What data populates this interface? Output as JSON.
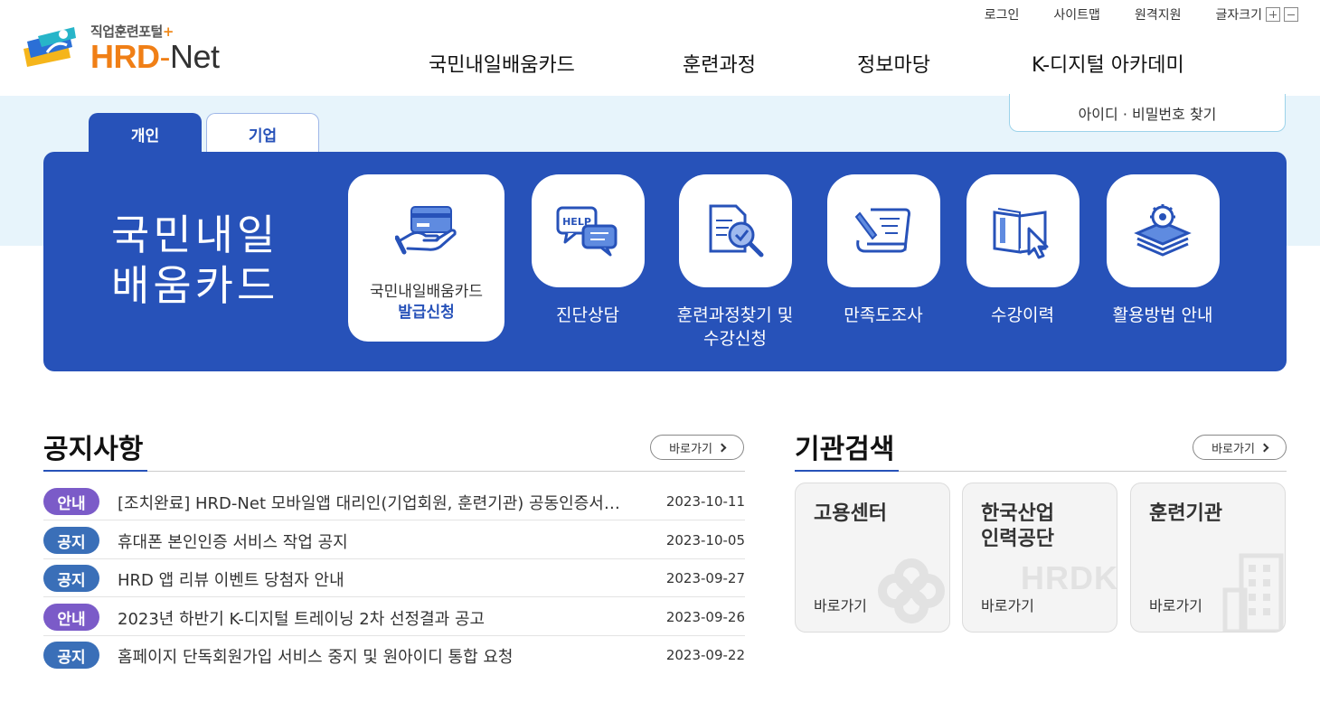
{
  "utility": {
    "login": "로그인",
    "sitemap": "사이트맵",
    "remote": "원격지원",
    "fontsize": "글자크기"
  },
  "logo": {
    "tagline": "직업훈련포털",
    "tagline_plus": "+",
    "brand_hrd": "HRD",
    "brand_dash": "-",
    "brand_net": "Net"
  },
  "gnb": [
    "국민내일배움카드",
    "훈련과정",
    "정보마당",
    "K-디지털 아카데미"
  ],
  "find_id": "아이디 · 비밀번호 찾기",
  "tabs": {
    "personal": "개인",
    "corporate": "기업"
  },
  "panel": {
    "title_line1": "국민내일",
    "title_line2": "배움카드",
    "card": {
      "line1": "국민내일배움카드",
      "line2": "발급신청"
    },
    "services": [
      {
        "label1": "진단상담",
        "label2": ""
      },
      {
        "label1": "훈련과정찾기 및",
        "label2": "수강신청"
      },
      {
        "label1": "만족도조사",
        "label2": ""
      },
      {
        "label1": "수강이력",
        "label2": ""
      },
      {
        "label1": "활용방법 안내",
        "label2": ""
      }
    ],
    "help_text": "HELP"
  },
  "notices_section": {
    "title": "공지사항",
    "goto": "바로가기",
    "items": [
      {
        "badge": "안내",
        "type": "info",
        "text": "[조치완료] HRD-Net 모바일앱 대리인(기업회원, 훈련기관) 공동인증서 로그인 오류 안내",
        "date": "2023-10-11"
      },
      {
        "badge": "공지",
        "type": "notice",
        "text": "휴대폰 본인인증 서비스 작업 공지",
        "date": "2023-10-05"
      },
      {
        "badge": "공지",
        "type": "notice",
        "text": "HRD 앱 리뷰 이벤트 당첨자 안내",
        "date": "2023-09-27"
      },
      {
        "badge": "안내",
        "type": "info",
        "text": "2023년 하반기 K-디지털 트레이닝 2차 선정결과 공고",
        "date": "2023-09-26"
      },
      {
        "badge": "공지",
        "type": "notice",
        "text": "홈페이지 단독회원가입 서비스 중지 및 원아이디 통합 요청",
        "date": "2023-09-22"
      }
    ]
  },
  "org_section": {
    "title": "기관검색",
    "goto": "바로가기",
    "orgs": [
      {
        "name1": "고용센터",
        "name2": "",
        "go": "바로가기"
      },
      {
        "name1": "한국산업",
        "name2": "인력공단",
        "go": "바로가기",
        "watermark": "HRDK"
      },
      {
        "name1": "훈련기관",
        "name2": "",
        "go": "바로가기"
      }
    ]
  },
  "colors": {
    "primary": "#2752b9",
    "accent_orange": "#f07f16",
    "badge_info": "#7b5bc8",
    "badge_notice": "#3a6fb8",
    "band": "#e7f4fb"
  }
}
